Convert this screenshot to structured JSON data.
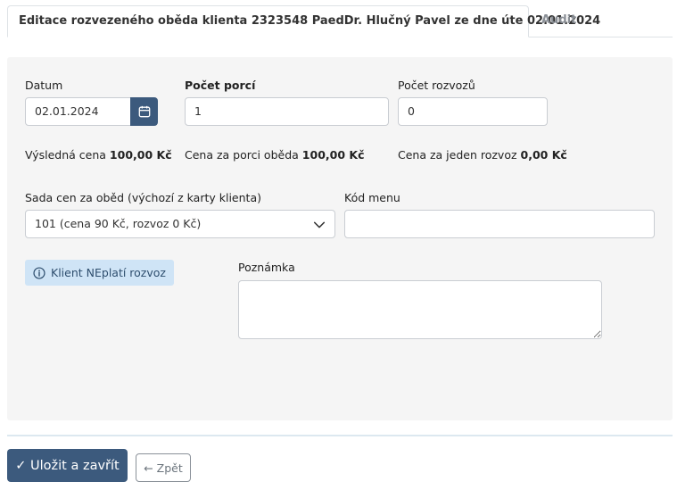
{
  "tabs": {
    "active": "Editace rozvezeného oběda klienta 2323548 PaedDr. Hlučný Pavel ze dne úte 02.01.2024",
    "audit": "Audit"
  },
  "form": {
    "datum_label": "Datum",
    "datum_value": "02.01.2024",
    "pocet_porci_label": "Počet porcí",
    "pocet_porci_value": "1",
    "pocet_rozvozu_label": "Počet rozvozů",
    "pocet_rozvozu_value": "0",
    "vysledna_cena_label": "Výsledná cena",
    "vysledna_cena_value": "100,00 Kč",
    "cena_porci_label": "Cena za porci oběda",
    "cena_porci_value": "100,00 Kč",
    "cena_rozvoz_label": "Cena za jeden rozvoz",
    "cena_rozvoz_value": "0,00 Kč",
    "sada_cen_label": "Sada cen za oběd (výchozí z karty klienta)",
    "sada_cen_value": "101 (cena 90 Kč, rozvoz 0 Kč)",
    "kod_menu_label": "Kód menu",
    "kod_menu_value": "",
    "badge_text": "Klient NEplatí rozvoz",
    "poznamka_label": "Poznámka",
    "poznamka_value": ""
  },
  "actions": {
    "save_label": "✓ Uložit a zavřít",
    "back_label": "← Zpět"
  },
  "icons": {
    "calendar": "calendar-icon",
    "chevron": "chevron-down-icon",
    "info": "info-circle-icon"
  },
  "colors": {
    "primary": "#3c5a7d",
    "panel_bg": "#f5f5f5",
    "badge_bg": "#cfe4f6"
  }
}
